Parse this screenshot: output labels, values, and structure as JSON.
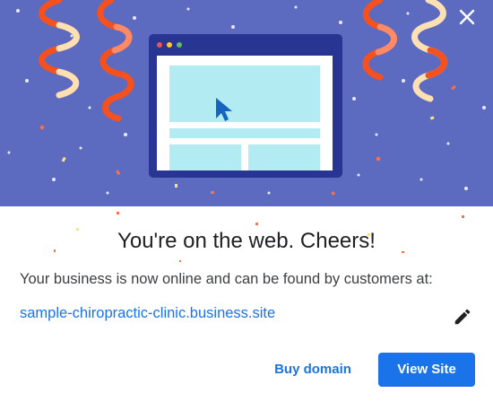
{
  "dialog": {
    "title": "You're on the web. Cheers!",
    "message": "Your business is now online and can be found by customers at:",
    "site_url": "sample-chiropractic-clinic.business.site",
    "buy_domain_label": "Buy domain",
    "view_site_label": "View Site"
  },
  "icons": {
    "close": "close-icon",
    "edit": "pencil-icon",
    "cursor": "mouse-cursor-icon"
  },
  "colors": {
    "hero_background": "#5c6bc0",
    "window_frame": "#283593",
    "window_content": "#b2ebf2",
    "link": "#1a73e8",
    "primary_button": "#1a73e8",
    "streamer_red": "#f4511e",
    "streamer_cream": "#ffe0b2"
  }
}
